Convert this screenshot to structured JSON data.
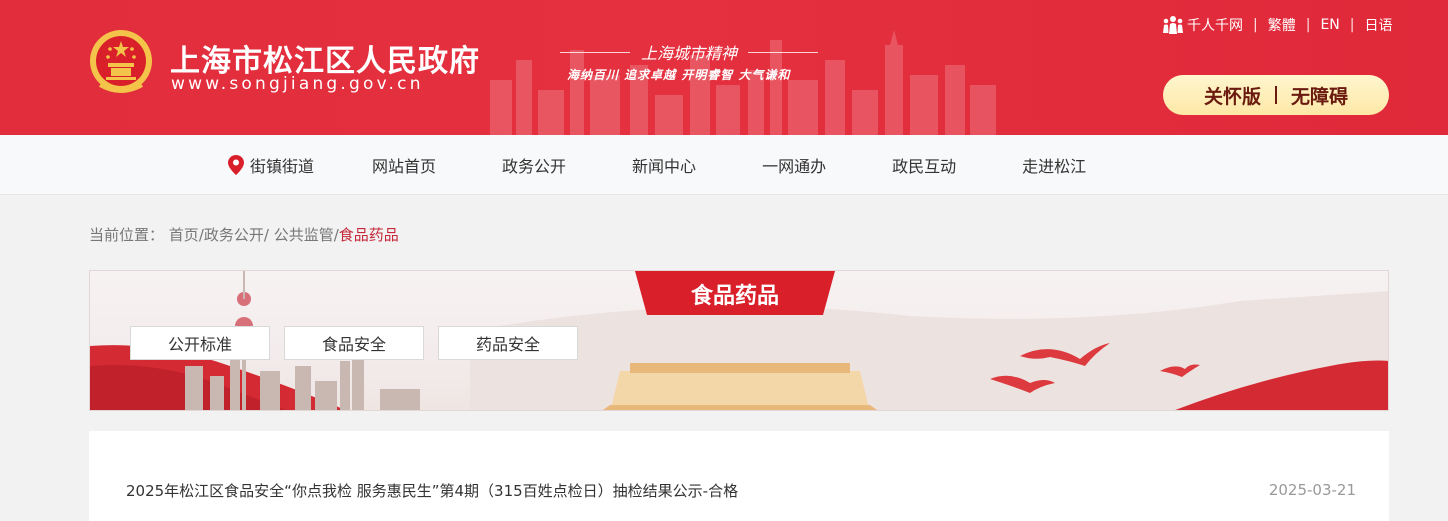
{
  "header": {
    "site_name": "上海市松江区人民政府",
    "site_url": "www.songjiang.gov.cn",
    "spirit_title": "上海城市精神",
    "spirit_slogan": "海纳百川  追求卓越  开明睿智  大气谦和",
    "top_links": [
      "千人千网",
      "繁體",
      "EN",
      "日语"
    ],
    "care_label": "关怀版",
    "accessible_label": "无障碍"
  },
  "nav": {
    "items": [
      "街镇街道",
      "网站首页",
      "政务公开",
      "新闻中心",
      "一网通办",
      "政民互动",
      "走进松江"
    ]
  },
  "breadcrumb": {
    "prefix": "当前位置：",
    "crumbs": [
      "首页",
      "/政务公开",
      "/ 公共监管",
      "/"
    ],
    "current": "食品药品"
  },
  "banner": {
    "title": "食品药品",
    "tabs": [
      "公开标准",
      "食品安全",
      "药品安全"
    ]
  },
  "list": {
    "items": [
      {
        "title": "2025年松江区食品安全“你点我检 服务惠民生”第4期（315百姓点检日）抽检结果公示-合格",
        "date": "2025-03-21"
      }
    ]
  },
  "colors": {
    "brand_red": "#e22d3c",
    "accent_red": "#c6283a",
    "care_bg": "#fde8a6"
  }
}
